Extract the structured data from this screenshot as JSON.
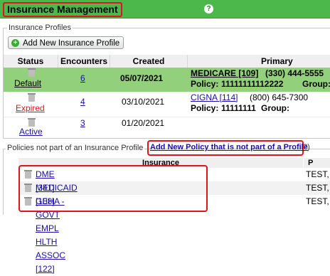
{
  "header": {
    "title": "Insurance Management",
    "help_icon": "?"
  },
  "profiles_section": {
    "legend": "Insurance Profiles",
    "add_button_label": "Add New Insurance Profile",
    "columns": [
      "Status",
      "Encounters",
      "Created",
      "Primary"
    ],
    "rows": [
      {
        "status": "Default",
        "encounters": "6",
        "created": "05/07/2021",
        "primary_name": "MEDICARE [109]",
        "primary_phone": "(330) 444-5555",
        "policy_label": "Policy:",
        "policy_number": "11111111112222",
        "group_label": "Group:"
      },
      {
        "status": "Expired",
        "encounters": "4",
        "created": "03/10/2021",
        "primary_name": "CIGNA [114]",
        "primary_phone": "(800) 645-7300",
        "policy_label": "Policy:",
        "policy_number": "11111111",
        "group_label": "Group:"
      },
      {
        "status": "Active",
        "encounters": "3",
        "created": "01/20/2021",
        "primary_name": "",
        "primary_phone": "",
        "policy_label": "",
        "policy_number": "",
        "group_label": ""
      }
    ]
  },
  "policies_section": {
    "legend": "Policies not part of an Insurance Profile",
    "add_link": "Add New Policy that is not part of a Profile",
    "legend_suffix": "?)",
    "columns": [
      "Insurance",
      "P"
    ],
    "rows": [
      {
        "name": "DME [341]",
        "other": "TEST,"
      },
      {
        "name": "MEDICAID [108]",
        "other": "TEST,"
      },
      {
        "name": "GEHA - GOVT EMPL HLTH ASSOC [122]",
        "other": "TEST,"
      }
    ]
  },
  "colors": {
    "header_green": "#4cb84c",
    "default_row_green": "#93d07b",
    "highlight_red": "#e0141e",
    "link_blue": "#1a0dab"
  }
}
